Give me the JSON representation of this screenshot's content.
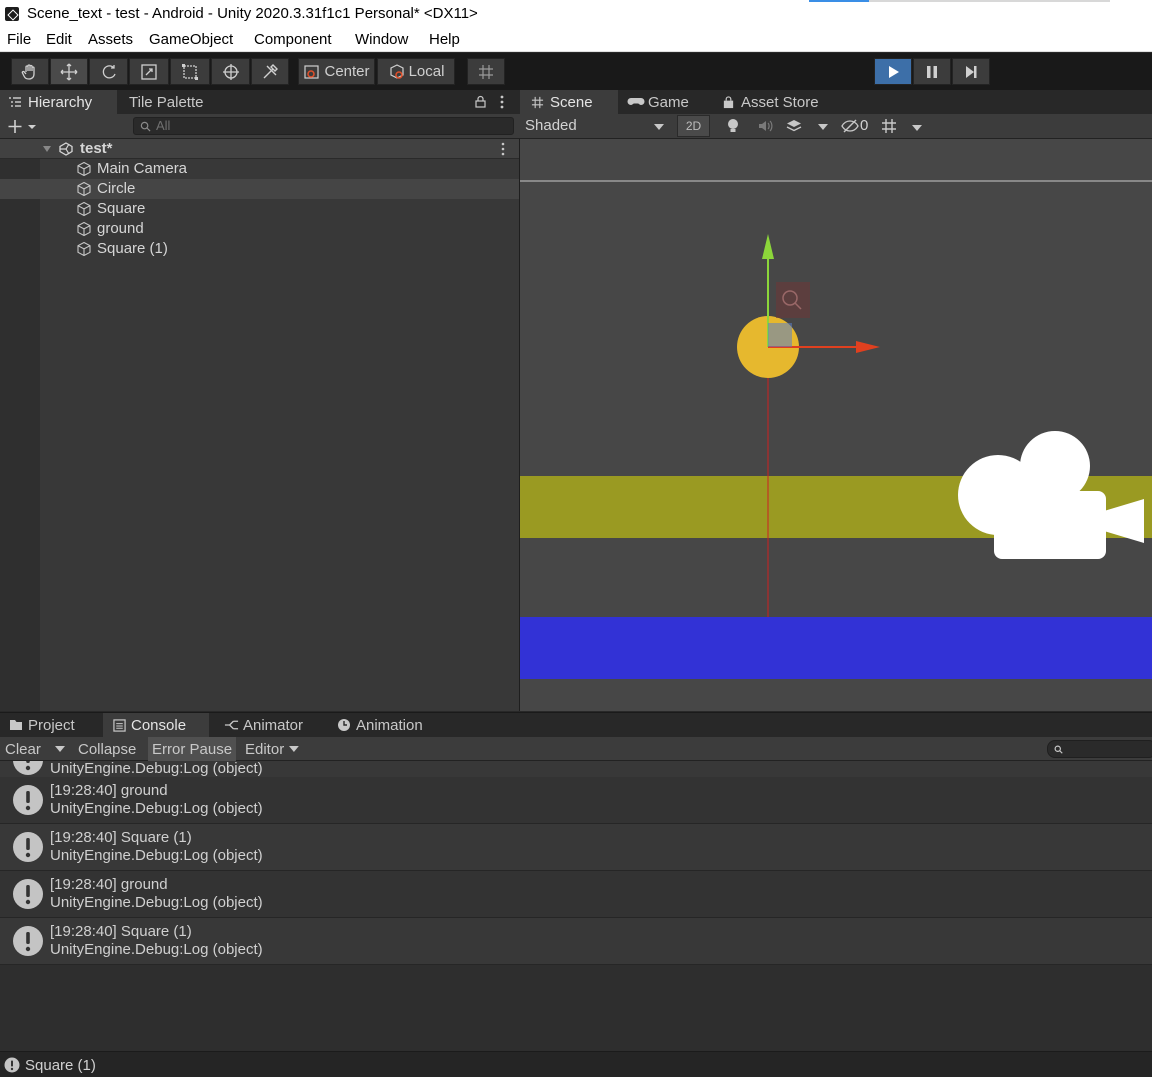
{
  "window": {
    "title": "Scene_text - test - Android - Unity 2020.3.31f1c1 Personal* <DX11>"
  },
  "menu": [
    "File",
    "Edit",
    "Assets",
    "GameObject",
    "Component",
    "Window",
    "Help"
  ],
  "toolbar": {
    "pivot_label": "Center",
    "space_label": "Local"
  },
  "hierarchy": {
    "tabs": [
      "Hierarchy",
      "Tile Palette"
    ],
    "search_placeholder": "All",
    "scene_name": "test*",
    "objects": [
      "Main Camera",
      "Circle",
      "Square",
      "ground",
      "Square (1)"
    ],
    "selected": "Circle"
  },
  "scene": {
    "tabs": [
      "Scene",
      "Game",
      "Asset Store"
    ],
    "shading_mode": "Shaded",
    "mode_2d": "2D",
    "hidden_count": "0",
    "colors": {
      "ground_band": "#9a9a22",
      "blue_band": "#3232d6",
      "circle": "#e6b82e",
      "background": "#474747"
    }
  },
  "bottom": {
    "tabs": [
      "Project",
      "Console",
      "Animator",
      "Animation"
    ],
    "console_buttons": {
      "clear": "Clear",
      "collapse": "Collapse",
      "error_pause": "Error Pause",
      "editor": "Editor"
    },
    "partial_line": "UnityEngine.Debug:Log (object)",
    "logs": [
      {
        "message": "[19:28:40] ground",
        "trace": "UnityEngine.Debug:Log (object)"
      },
      {
        "message": "[19:28:40] Square (1)",
        "trace": "UnityEngine.Debug:Log (object)"
      },
      {
        "message": "[19:28:40] ground",
        "trace": "UnityEngine.Debug:Log (object)"
      },
      {
        "message": "[19:28:40] Square (1)",
        "trace": "UnityEngine.Debug:Log (object)"
      }
    ]
  },
  "status": {
    "message": "Square (1)"
  }
}
